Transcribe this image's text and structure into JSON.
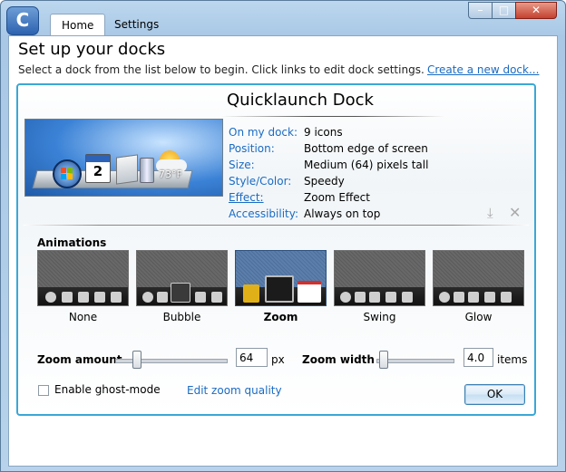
{
  "window": {
    "tabs": [
      {
        "label": "Home",
        "active": true
      },
      {
        "label": "Settings",
        "active": false
      }
    ],
    "logo_icon": "objectdock-logo-icon",
    "controls": {
      "minimize": "–",
      "maximize": "□",
      "close": "✕"
    }
  },
  "page": {
    "title": "Set up your docks",
    "subtitle": "Select a dock from the list below to begin.  Click links to edit dock settings.",
    "create_link": "Create a new dock..."
  },
  "dock": {
    "name": "Quicklaunch Dock",
    "preview_temp": "73°F",
    "preview_calendar_day": "2",
    "properties": [
      {
        "label": "On my dock:",
        "value": "9 icons",
        "link": false
      },
      {
        "label": "Position:",
        "value": "Bottom edge of screen",
        "link": false
      },
      {
        "label": "Size:",
        "value": "Medium (64) pixels tall",
        "link": false
      },
      {
        "label": "Style/Color:",
        "value": "Speedy",
        "link": false
      },
      {
        "label": "Effect:",
        "value": "Zoom Effect",
        "link": true
      },
      {
        "label": "Accessibility:",
        "value": "Always on top",
        "link": false
      }
    ]
  },
  "animations": {
    "title": "Animations",
    "options": [
      {
        "label": "None",
        "selected": false
      },
      {
        "label": "Bubble",
        "selected": false
      },
      {
        "label": "Zoom",
        "selected": true
      },
      {
        "label": "Swing",
        "selected": false
      },
      {
        "label": "Glow",
        "selected": false
      }
    ]
  },
  "zoom_amount": {
    "label": "Zoom amount",
    "value": "64",
    "unit": "px",
    "slider_fraction": 0.2
  },
  "zoom_width": {
    "label": "Zoom width",
    "value": "4.0",
    "unit": "items",
    "slider_fraction": 0.1
  },
  "ghost_mode": {
    "label": "Enable ghost-mode",
    "checked": false
  },
  "edit_zoom_link": "Edit zoom quality",
  "ok_label": "OK",
  "colors": {
    "accent": "#3aa7d6",
    "link": "#1a6bc4",
    "selected_anim": "#4e6f9c"
  }
}
